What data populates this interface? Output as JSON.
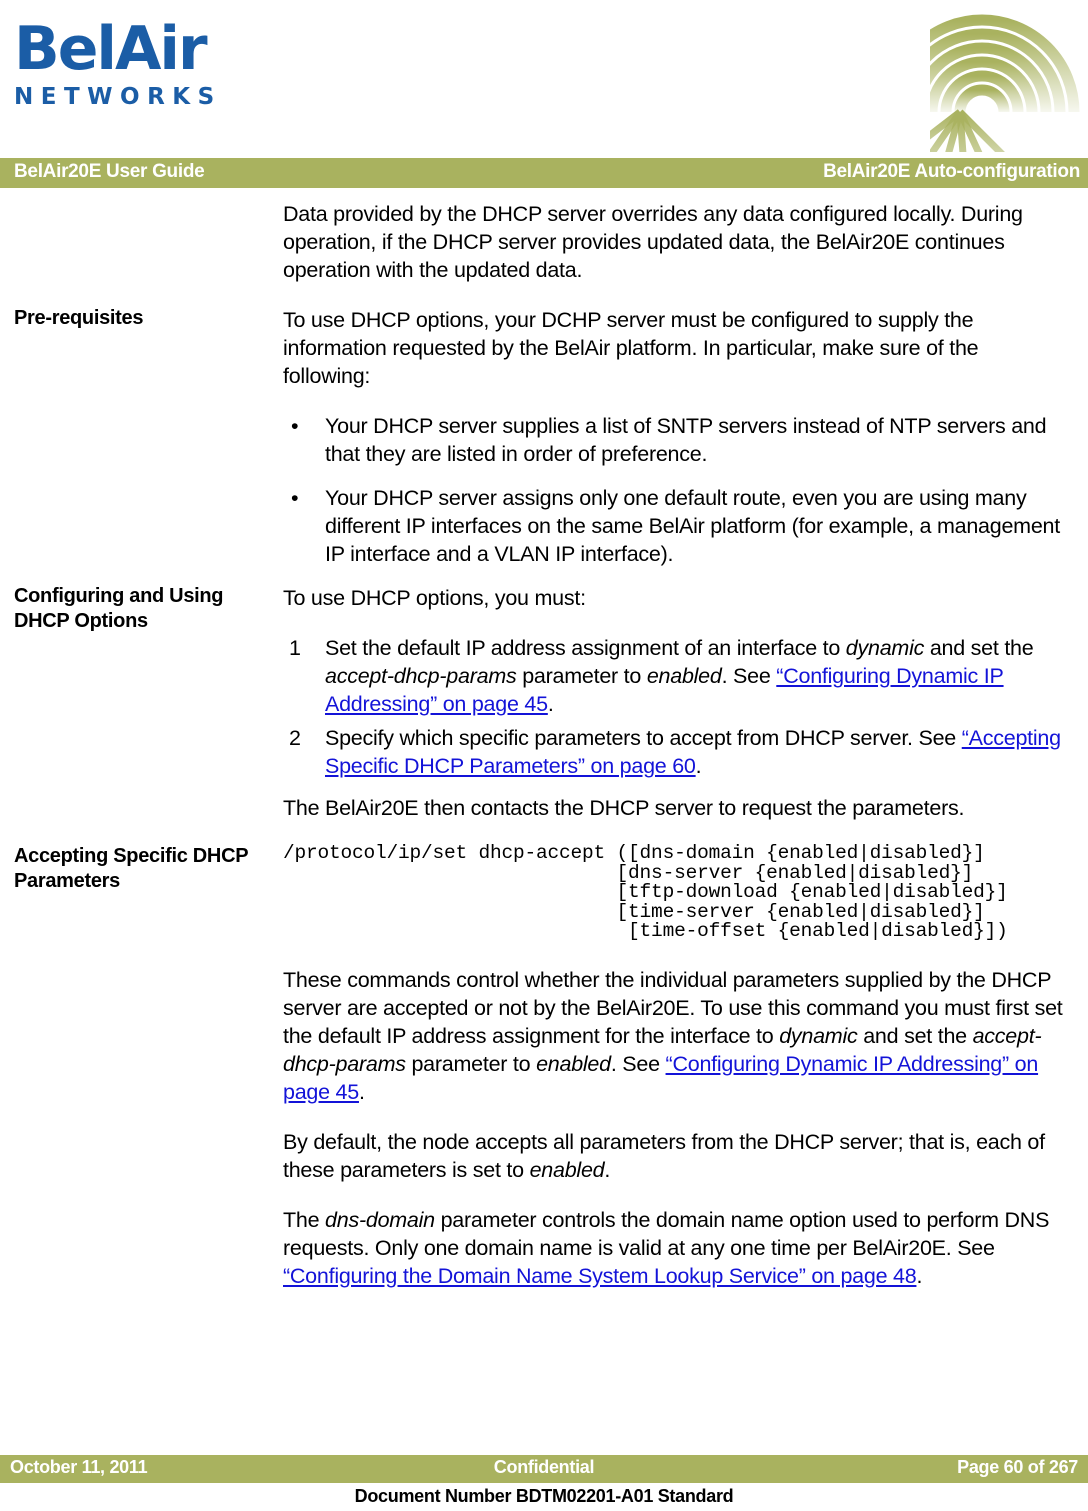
{
  "colors": {
    "brand_blue": "#1B5DA6",
    "band_olive": "#A9B25F",
    "link_blue": "#1313D8",
    "text_black": "#000000",
    "band_text": "#FFFFFF"
  },
  "logo": {
    "wordmark": "BelAir",
    "submark": "NETWORKS",
    "decoration": "fan-graphic"
  },
  "header": {
    "left": "BelAir20E User Guide",
    "right": "BelAir20E Auto-configuration"
  },
  "body": {
    "intro_paragraph": "Data provided by the DHCP server overrides any data configured locally. During operation, if the DHCP server provides updated data, the BelAir20E continues operation with the updated data.",
    "sections": [
      {
        "heading": "Pre-requisites",
        "lead": "To use DHCP options, your DCHP server must be configured to supply the information requested by the BelAir platform. In particular, make sure of the following:",
        "bullet_marker": "•",
        "bullets": [
          "Your DHCP server supplies a list of SNTP servers instead of NTP servers and that they are listed in order of preference.",
          "Your DHCP server assigns only one default route, even you are using many different IP interfaces on the same BelAir platform (for example, a management IP interface and a VLAN IP interface)."
        ]
      },
      {
        "heading": "Configuring and Using DHCP Options",
        "lead": "To use DHCP options, you must:",
        "steps": [
          {
            "number": "1",
            "text_before": "Set the default IP address assignment of an interface to ",
            "em1": "dynamic",
            "text_mid1": " and set the ",
            "em2": "accept-dhcp-params",
            "text_mid2": " parameter to ",
            "em3": "enabled",
            "text_mid3": ". See ",
            "link": "“Configuring Dynamic IP Addressing” on page 45",
            "text_after": "."
          },
          {
            "number": "2",
            "text_before": "Specify which specific parameters to accept from DHCP server. See ",
            "link": "“Accepting Specific DHCP Parameters” on page 60",
            "text_after": "."
          }
        ],
        "closing": "The BelAir20E then contacts the DHCP server to request the parameters."
      },
      {
        "heading": "Accepting Specific DHCP Parameters",
        "code": "/protocol/ip/set dhcp-accept ([dns-domain {enabled|disabled}]\n                             [dns-server {enabled|disabled}]\n                             [tftp-download {enabled|disabled}]\n                             [time-server {enabled|disabled}]\n                              [time-offset {enabled|disabled}])",
        "paragraphs": [
          {
            "id": "p-commands-control",
            "t1": "These commands control whether the individual parameters supplied by the DHCP server are accepted or not by the BelAir20E. To use this command you must first set the default IP address assignment for the interface to ",
            "em1": "dynamic",
            "t2": " and set the ",
            "em2": "accept-dhcp-params",
            "t3": " parameter to ",
            "em3": "enabled",
            "t4": ". See ",
            "link": "“Configuring Dynamic IP Addressing” on page 45",
            "t5": "."
          },
          {
            "id": "p-by-default",
            "t1": "By default, the node accepts all parameters from the DHCP server; that is, each of these parameters is set to ",
            "em1": "enabled",
            "t2": "."
          },
          {
            "id": "p-dns-domain",
            "t1": "The ",
            "em1": "dns-domain",
            "t2": " parameter controls the domain name option used to perform DNS requests. Only one domain name is valid at any one time per BelAir20E. See ",
            "link": "“Configuring the Domain Name System Lookup Service” on page 48",
            "t3": "."
          }
        ]
      }
    ]
  },
  "footer": {
    "date": "October 11, 2011",
    "classification": "Confidential",
    "page": "Page 60 of 267",
    "document_number": "Document Number BDTM02201-A01 Standard"
  }
}
